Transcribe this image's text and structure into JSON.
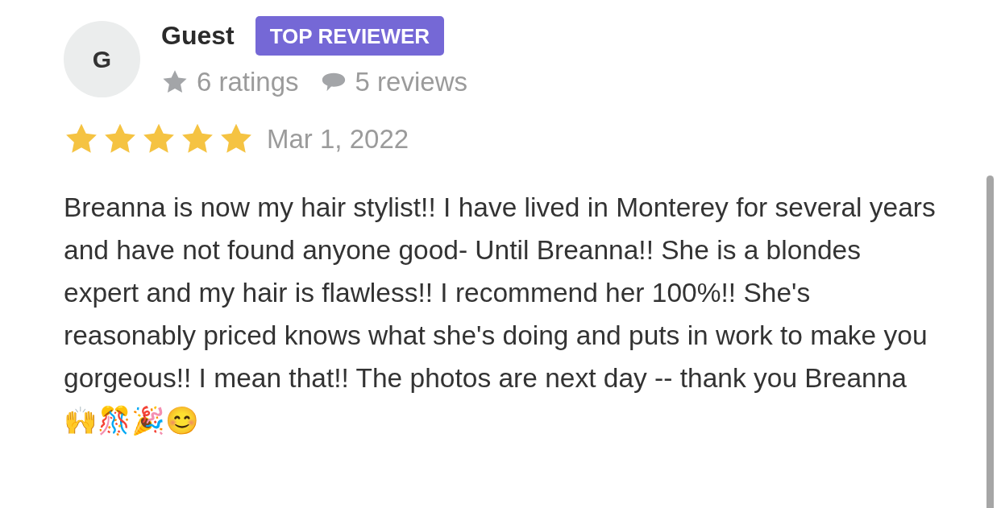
{
  "reviewer": {
    "avatar_letter": "G",
    "name": "Guest",
    "badge": "TOP REVIEWER",
    "ratings": "6 ratings",
    "reviews": "5 reviews"
  },
  "review": {
    "stars": 5,
    "date": "Mar 1, 2022",
    "text": "Breanna is now my hair stylist!! I have lived in Monterey for several years and have not found anyone good- Until Breanna!! She is a blondes expert and my hair is flawless!! I recommend her 100%!! She's reasonably priced knows what she's doing and puts in work to make you gorgeous!! I mean that!! The photos are next day -- thank you Breanna 🙌🎊🎉😊"
  }
}
